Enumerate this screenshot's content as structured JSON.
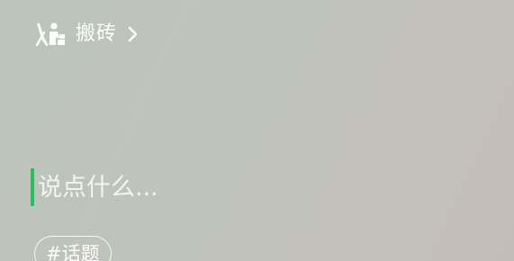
{
  "status": {
    "icon": "worker-carrying-bricks-icon",
    "label": "搬砖"
  },
  "compose": {
    "placeholder": "说点什么...",
    "value": "",
    "cursor_color": "#2dbe5a"
  },
  "topic": {
    "label": "#话题"
  }
}
